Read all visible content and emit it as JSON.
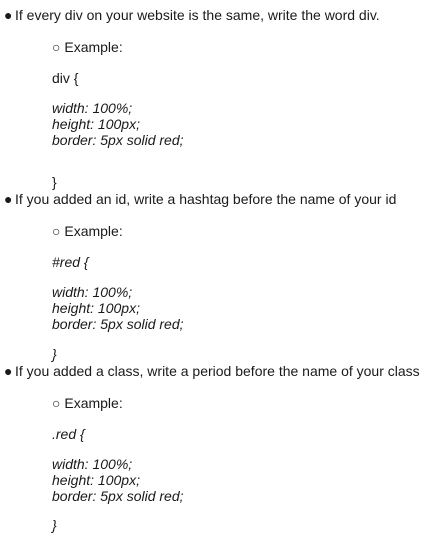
{
  "bullet_glyph": "●",
  "sub_glyph": "○",
  "sections": [
    {
      "bullet": "If every div on your website is the same, write the word div.",
      "example_label": "Example:",
      "selector_line": "div {",
      "selector_italic": false,
      "properties": [
        "width: 100%;",
        "height: 100px;",
        "border: 5px solid red;"
      ],
      "close": "}",
      "close_italic": false
    },
    {
      "bullet": "If you added an id, write a hashtag before the name of your id",
      "example_label": "Example:",
      "selector_line": "#red {",
      "selector_italic": true,
      "properties": [
        "width: 100%;",
        "height: 100px;",
        "border: 5px solid red;"
      ],
      "close": "}",
      "close_italic": true
    },
    {
      "bullet": "If you added a class, write a period before the name of your class",
      "example_label": "Example:",
      "selector_line": ".red {",
      "selector_italic": true,
      "properties": [
        "width: 100%;",
        "height: 100px;",
        "border: 5px solid red;"
      ],
      "close": "}",
      "close_italic": true
    }
  ]
}
